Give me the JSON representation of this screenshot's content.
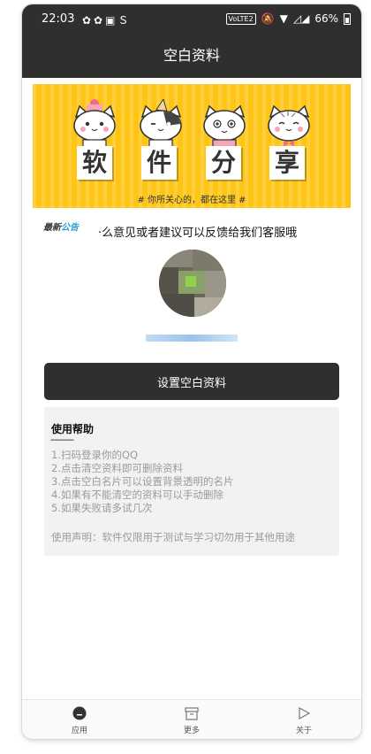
{
  "status_bar": {
    "time": "22:03",
    "left_icons": [
      "notification-icon",
      "notification-icon",
      "app-icon",
      "app-icon"
    ],
    "volte": "VoLTE2",
    "battery": "66%"
  },
  "header": {
    "title": "空白资料"
  },
  "banner": {
    "chars": [
      "软",
      "件",
      "分",
      "享"
    ],
    "slogan": "# 你所关心的，都在这里 #"
  },
  "notice": {
    "tag_part1": "最新",
    "tag_part2": "公告",
    "text": "·么意见或者建议可以反馈给我们客服哦"
  },
  "action": {
    "button_label": "设置空白资料"
  },
  "help": {
    "title": "使用帮助",
    "rule": "----------",
    "items": [
      "1.扫码登录你的QQ",
      "2.点击清空资料即可删除资料",
      "3.点击空白名片可以设置背景透明的名片",
      "4.如果有不能清空的资料可以手动删除",
      "5.如果失败请多试几次"
    ],
    "disclaimer": "使用声明：软件仅限用于测试与学习切勿用于其他用途"
  },
  "tabs": [
    {
      "label": "应用",
      "icon": "app-icon"
    },
    {
      "label": "更多",
      "icon": "box-icon"
    },
    {
      "label": "关于",
      "icon": "play-icon"
    }
  ],
  "colors": {
    "dark": "#2f2f2f",
    "banner": "#ffc515",
    "accent": "#1e9fd6"
  }
}
